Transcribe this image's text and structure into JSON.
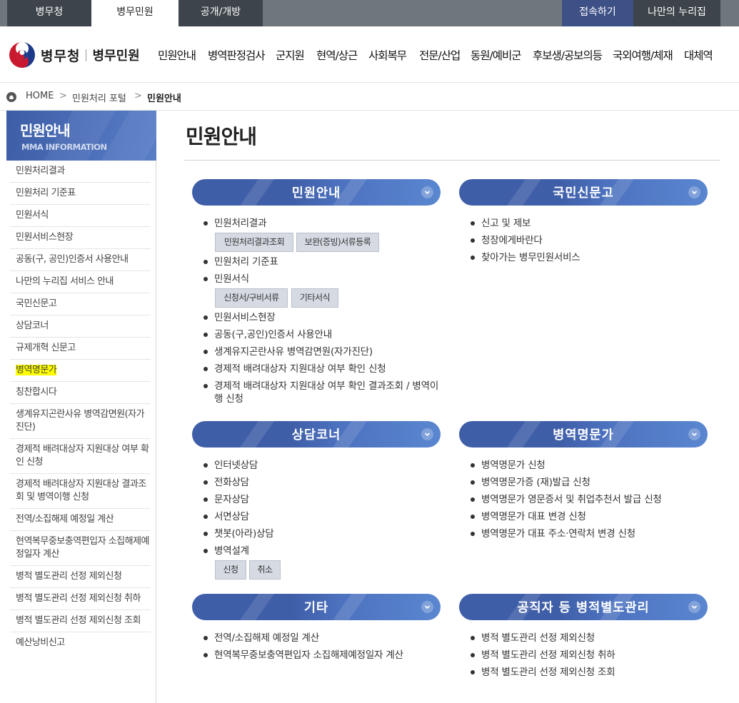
{
  "topbar": {
    "tabs": [
      "병무청",
      "병무민원",
      "공개/개방"
    ],
    "login": "접속하기",
    "my": "나만의 누리집"
  },
  "header": {
    "logo_org": "병무청",
    "logo_service": "병무민원",
    "gnb": [
      "민원안내",
      "병역판정검사",
      "군지원",
      "현역/상근",
      "사회복무",
      "전문/산업",
      "동원/예비군",
      "후보생/공보의등",
      "국외여행/체재",
      "대체역"
    ]
  },
  "breadcrumb": {
    "home": "HOME",
    "sep": ">",
    "mid": "민원처리 포털",
    "current": "민원안내"
  },
  "sidebar": {
    "title": "민원안내",
    "subtitle": "MMA INFORMATION",
    "items": [
      "민원처리결과",
      "민원처리 기준표",
      "민원서식",
      "민원서비스현장",
      "공동(구, 공인)인증서 사용안내",
      "나만의 누리집 서비스 안내",
      "국민신문고",
      "상담코너",
      "규제개혁 신문고",
      "병역명문가",
      "칭찬합시다",
      "생계유지곤란사유 병역감면원(자가진단)",
      "경제적 배려대상자 지원대상 여부 확인 신청",
      "경제적 배려대상자 지원대상 결과조회 및 병역이행 신청",
      "전역/소집해제 예정일 계산",
      "현역복무중보충역편입자 소집해제예정일자 계산",
      "병적 별도관리 선정 제외신청",
      "병적 별도관리 선정 제외신청 취하",
      "병적 별도관리 선정 제외신청 조회",
      "예산낭비신고"
    ]
  },
  "main": {
    "title": "민원안내",
    "sections": {
      "civil": {
        "title": "민원안내",
        "items": [
          "민원처리결과",
          "민원처리 기준표",
          "민원서식",
          "민원서비스현장",
          "공동(구,공인)인증서 사용안내",
          "생계유지곤란사유 병역감면원(자가진단)",
          "경제적 배려대상자 지원대상 여부 확인 신청",
          "경제적 배려대상자 지원대상 여부 확인 결과조회 / 병역이행 신청"
        ],
        "result_buttons": [
          "민원처리결과조회",
          "보완(증빙)서류등록"
        ],
        "form_buttons": [
          "신청서/구비서류",
          "기타서식"
        ]
      },
      "sinmungo": {
        "title": "국민신문고",
        "items": [
          "신고 및 제보",
          "청장에게바란다",
          "찾아가는 병무민원서비스"
        ]
      },
      "counsel": {
        "title": "상담코너",
        "items": [
          "인터넷상담",
          "전화상담",
          "문자상담",
          "서면상담",
          "챗봇(아라)상담",
          "병역설계"
        ],
        "buttons": [
          "신청",
          "취소"
        ]
      },
      "family": {
        "title": "병역명문가",
        "items": [
          "병역명문가 신청",
          "병역명문가증 (재)발급 신청",
          "병역명문가 영문증서 및 취업추천서 발급 신청",
          "병역명문가 대표 변경 신청",
          "병역명문가 대표 주소·연락처 변경 신청"
        ]
      },
      "etc": {
        "title": "기타",
        "items": [
          "전역/소집해제 예정일 계산",
          "현역복무중보충역편입자 소집해제예정일자 계산"
        ]
      },
      "official": {
        "title": "공직자 등 병적별도관리",
        "items": [
          "병적 별도관리 선정 제외신청",
          "병적 별도관리 선정 제외신청 취하",
          "병적 별도관리 선정 제외신청 조회"
        ]
      }
    }
  },
  "colors": {
    "bar": "#3f5ea8",
    "dark": "#3d444b",
    "highlight": "#ffff00"
  }
}
